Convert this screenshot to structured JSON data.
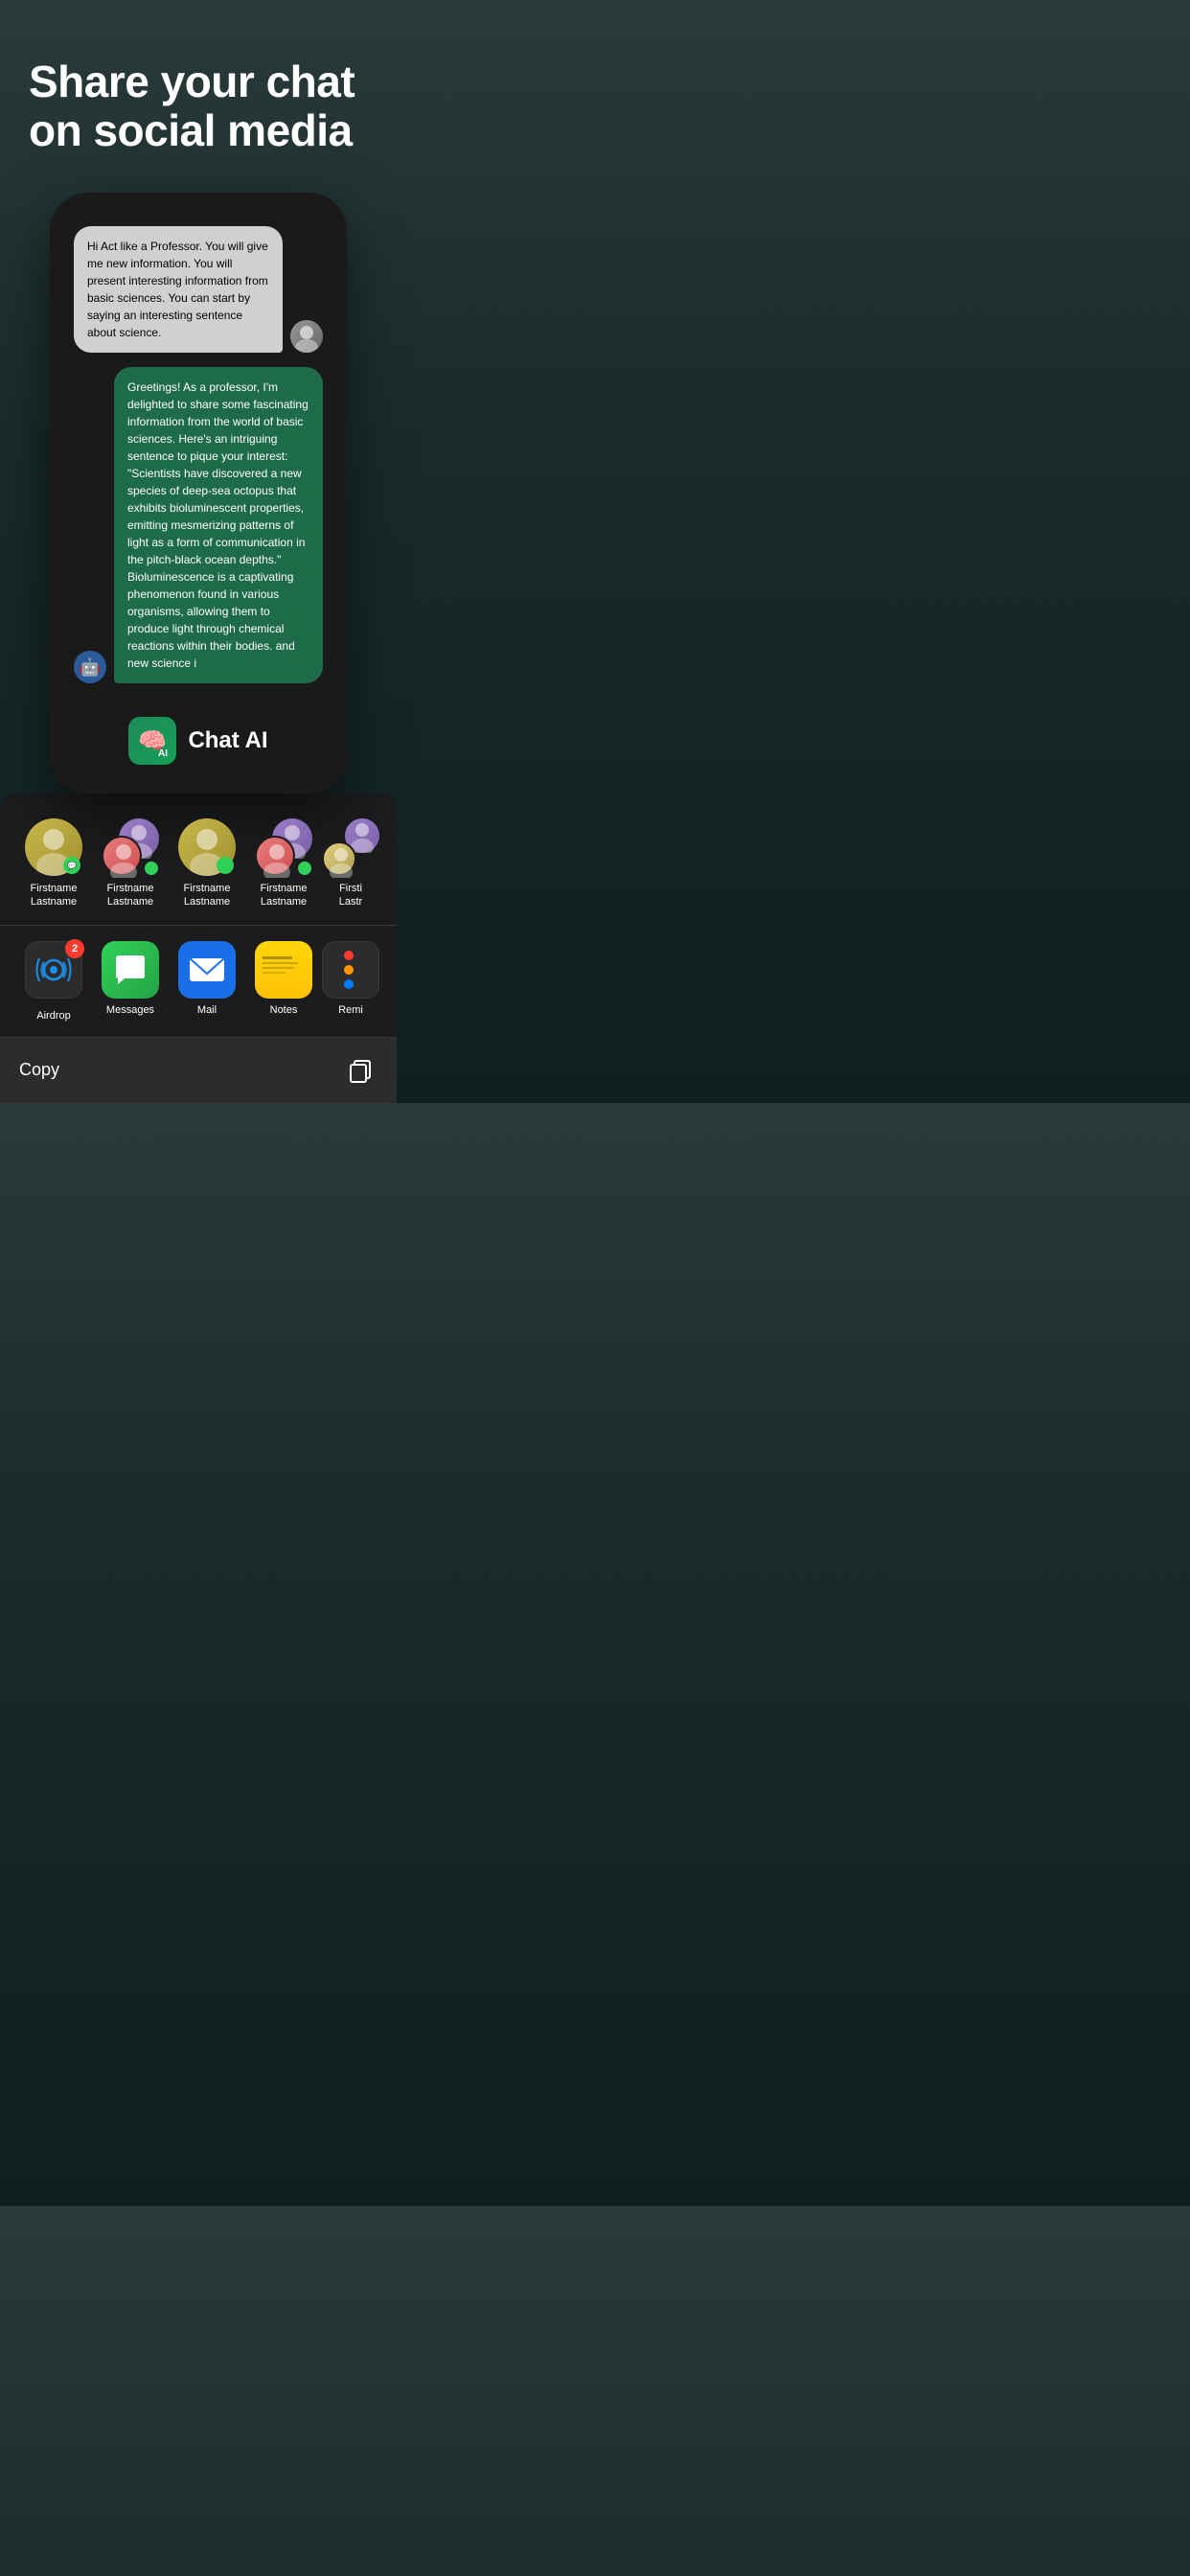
{
  "header": {
    "title": "Share your chat\non social media"
  },
  "chat": {
    "user_message": "Hi Act like a Professor. You will give me new information. You will present interesting information from basic sciences. You can start by saying an interesting sentence about science.",
    "ai_message": "Greetings! As a professor, I'm delighted to share some fascinating information from the world of basic sciences. Here's an intriguing sentence to pique your interest: \"Scientists have discovered a new species of deep-sea octopus that exhibits bioluminescent properties, emitting mesmerizing patterns of light as a form of communication in the pitch-black ocean depths.\" Bioluminescence is a captivating phenomenon found in various organisms, allowing them to produce light through chemical reactions within their bodies. and new science i"
  },
  "app_branding": {
    "name": "Chat AI",
    "icon_emoji": "🧠"
  },
  "contacts": [
    {
      "name": "Firstname\nLastname",
      "avatar_style": "yellow"
    },
    {
      "name": "Firstname\nLastname",
      "avatar_style": "purple-pink"
    },
    {
      "name": "Firstname\nLastname",
      "avatar_style": "yellow"
    },
    {
      "name": "Firstname\nLastname",
      "avatar_style": "purple-pink"
    },
    {
      "name": "Firsti\nLastr",
      "avatar_style": "purple"
    }
  ],
  "share_apps": [
    {
      "name": "Airdrop",
      "icon_type": "airdrop",
      "badge": "2"
    },
    {
      "name": "Messages",
      "icon_type": "messages"
    },
    {
      "name": "Mail",
      "icon_type": "mail"
    },
    {
      "name": "Notes",
      "icon_type": "notes"
    },
    {
      "name": "Remi",
      "icon_type": "reminders"
    }
  ],
  "copy_bar": {
    "label": "Copy",
    "icon": "copy-icon"
  }
}
